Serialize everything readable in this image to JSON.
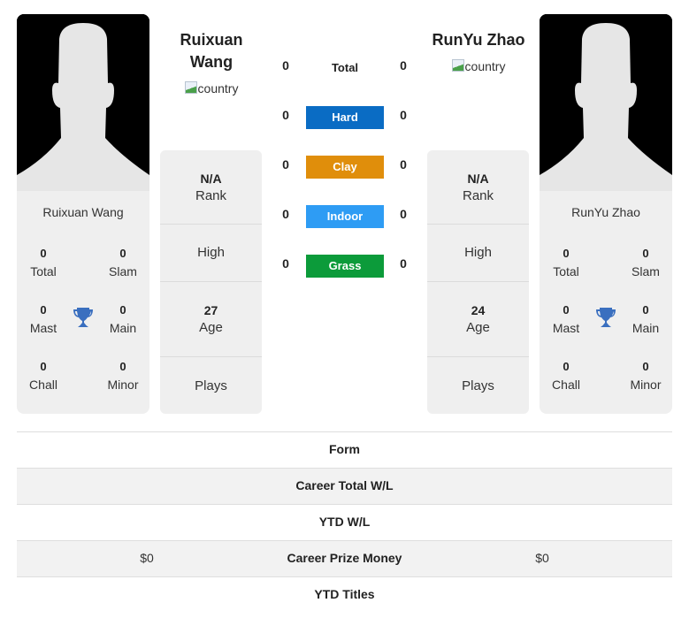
{
  "players": {
    "left": {
      "name": "Ruixuan Wang",
      "header_name_line1": "Ruixuan",
      "header_name_line2": "Wang",
      "flag_alt": "country",
      "stats": {
        "total": {
          "value": "0",
          "label": "Total"
        },
        "slam": {
          "value": "0",
          "label": "Slam"
        },
        "mast": {
          "value": "0",
          "label": "Mast"
        },
        "main": {
          "value": "0",
          "label": "Main"
        },
        "chall": {
          "value": "0",
          "label": "Chall"
        },
        "minor": {
          "value": "0",
          "label": "Minor"
        }
      },
      "info": {
        "rank_value": "N/A",
        "rank_label": "Rank",
        "high_label": "High",
        "age_value": "27",
        "age_label": "Age",
        "plays_label": "Plays"
      }
    },
    "right": {
      "name": "RunYu Zhao",
      "header_name_line1": "RunYu Zhao",
      "flag_alt": "country",
      "stats": {
        "total": {
          "value": "0",
          "label": "Total"
        },
        "slam": {
          "value": "0",
          "label": "Slam"
        },
        "mast": {
          "value": "0",
          "label": "Mast"
        },
        "main": {
          "value": "0",
          "label": "Main"
        },
        "chall": {
          "value": "0",
          "label": "Chall"
        },
        "minor": {
          "value": "0",
          "label": "Minor"
        }
      },
      "info": {
        "rank_value": "N/A",
        "rank_label": "Rank",
        "high_label": "High",
        "age_value": "24",
        "age_label": "Age",
        "plays_label": "Plays"
      }
    }
  },
  "surfaces": [
    {
      "label": "Total",
      "left": "0",
      "right": "0",
      "color": null
    },
    {
      "label": "Hard",
      "left": "0",
      "right": "0",
      "color": "#0a6cc4"
    },
    {
      "label": "Clay",
      "left": "0",
      "right": "0",
      "color": "#e08e0b"
    },
    {
      "label": "Indoor",
      "left": "0",
      "right": "0",
      "color": "#2e9cf4"
    },
    {
      "label": "Grass",
      "left": "0",
      "right": "0",
      "color": "#0c9b3a"
    }
  ],
  "icons": {
    "trophy": "trophy-icon",
    "avatar": "silhouette-avatar",
    "flag": "broken-image-icon"
  },
  "trophy_color": "#3a6fbf",
  "comparison_table": [
    {
      "label": "Form",
      "left": "",
      "right": ""
    },
    {
      "label": "Career Total W/L",
      "left": "",
      "right": ""
    },
    {
      "label": "YTD W/L",
      "left": "",
      "right": ""
    },
    {
      "label": "Career Prize Money",
      "left": "$0",
      "right": "$0"
    },
    {
      "label": "YTD Titles",
      "left": "",
      "right": ""
    }
  ]
}
